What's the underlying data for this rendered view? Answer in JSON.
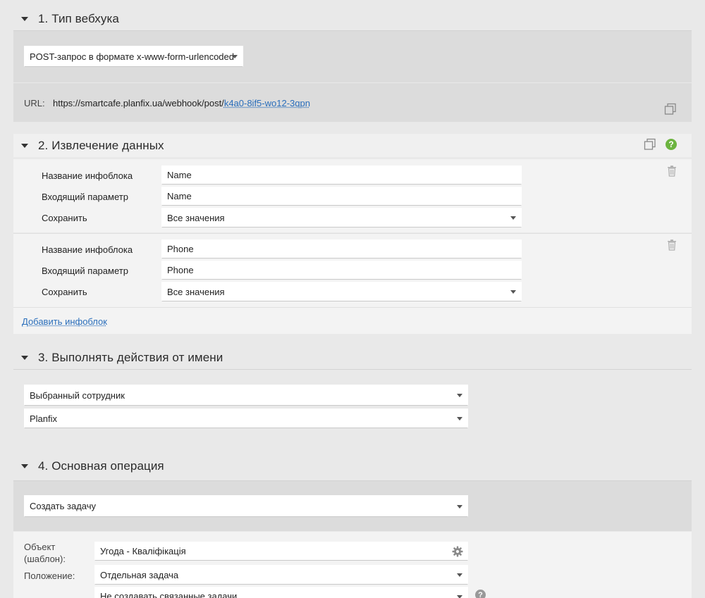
{
  "section1": {
    "title": "1. Тип вебхука",
    "webhook_type": "POST-запрос в формате x-www-form-urlencoded",
    "url_label": "URL:",
    "url_base": "https://smartcafe.planfix.ua/webhook/post/",
    "url_key": "k4a0-8if5-wo12-3qpn"
  },
  "section2": {
    "title": "2. Извлечение данных",
    "help": "?",
    "blocks": [
      {
        "name_label": "Название инфоблока",
        "name_value": "Name",
        "param_label": "Входящий параметр",
        "param_value": "Name",
        "save_label": "Сохранить",
        "save_value": "Все значения"
      },
      {
        "name_label": "Название инфоблока",
        "name_value": "Phone",
        "param_label": "Входящий параметр",
        "param_value": "Phone",
        "save_label": "Сохранить",
        "save_value": "Все значения"
      }
    ],
    "add_link": "Добавить инфоблок"
  },
  "section3": {
    "title": "3. Выполнять действия от имени",
    "mode": "Выбранный сотрудник",
    "employee": "Planfix"
  },
  "section4": {
    "title": "4. Основная операция",
    "operation": "Создать задачу",
    "object_label_line1": "Объект",
    "object_label_line2": "(шаблон):",
    "object_value": "Угода - Кваліфікація",
    "position_label": "Положение:",
    "position_value": "Отдельная задача",
    "related_value": "Не создавать связанные задачи",
    "help": "?"
  }
}
